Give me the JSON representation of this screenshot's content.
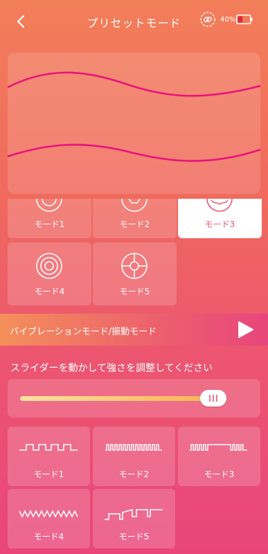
{
  "header": {
    "title": "プリセットモード",
    "battery_label": "40%",
    "battery_level": 0.4
  },
  "preset_modes": [
    {
      "label": "モード1",
      "selected": false,
      "icon": "concentric-circles-icon"
    },
    {
      "label": "モード2",
      "selected": false,
      "icon": "segmented-ring-icon"
    },
    {
      "label": "モード3",
      "selected": true,
      "icon": "wave-ring-icon"
    },
    {
      "label": "モード4",
      "selected": false,
      "icon": "triple-ring-icon"
    },
    {
      "label": "モード5",
      "selected": false,
      "icon": "cross-ring-icon"
    }
  ],
  "vibration_bar": {
    "label": "バイブレーションモード/振動モード"
  },
  "slider": {
    "label": "スライダーを動かして強さを調整してください",
    "value": 0.93
  },
  "vibration_modes": [
    {
      "label": "モード1",
      "icon": "square-wave-icon"
    },
    {
      "label": "モード2",
      "icon": "dense-pulse-icon"
    },
    {
      "label": "モード3",
      "icon": "burst-pulse-icon"
    },
    {
      "label": "モード4",
      "icon": "zigzag-wave-icon"
    },
    {
      "label": "モード5",
      "icon": "ramp-wave-icon"
    }
  ]
}
